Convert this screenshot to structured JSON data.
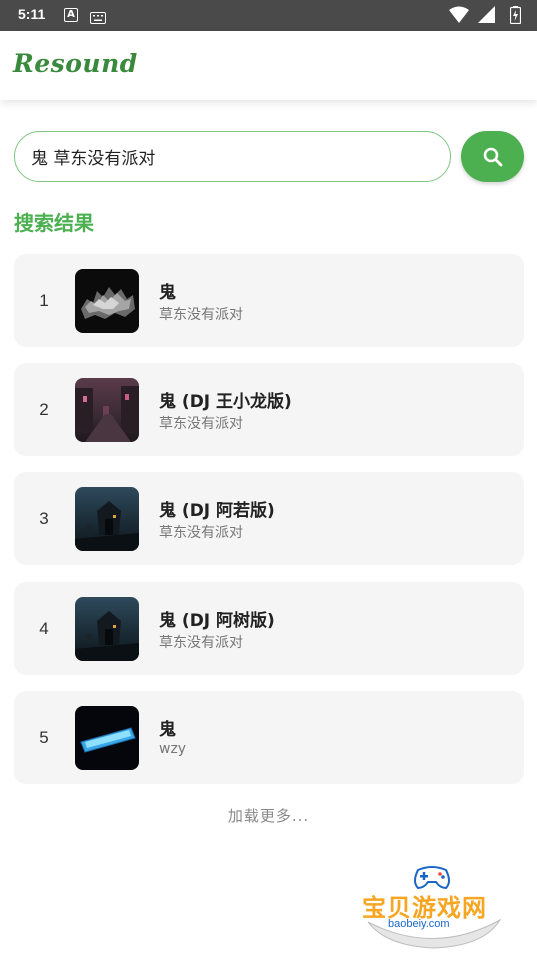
{
  "status_bar": {
    "time": "5:11",
    "icons": [
      "a-notification-icon",
      "keyboard-icon",
      "wifi-icon",
      "signal-icon",
      "battery-icon"
    ]
  },
  "app": {
    "title": "Resound",
    "accent_color": "#4caf50"
  },
  "search": {
    "query": "鬼 草东没有派对",
    "button_icon": "search-icon"
  },
  "results_section": {
    "title": "搜索结果"
  },
  "results": [
    {
      "rank": "1",
      "title": "鬼",
      "artist": "草东没有派对"
    },
    {
      "rank": "2",
      "title": "鬼 (DJ 王小龙版)",
      "artist": "草东没有派对"
    },
    {
      "rank": "3",
      "title": "鬼 (DJ 阿若版)",
      "artist": "草东没有派对"
    },
    {
      "rank": "4",
      "title": "鬼 (DJ 阿树版)",
      "artist": "草东没有派对"
    },
    {
      "rank": "5",
      "title": "鬼",
      "artist": "wzy"
    }
  ],
  "load_more": "加载更多...",
  "watermark": {
    "text": "宝贝游戏网",
    "url": "baobeiy.com"
  }
}
